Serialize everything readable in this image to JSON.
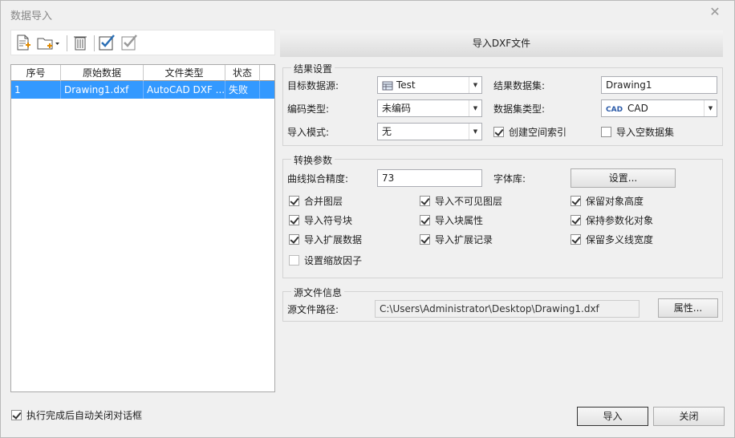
{
  "window": {
    "title": "数据导入",
    "close_glyph": "✕"
  },
  "toolbar": {
    "icons": [
      "add-file-icon",
      "add-folder-icon",
      "delete-icon",
      "select-all-icon",
      "invert-select-icon"
    ]
  },
  "grid": {
    "columns": [
      "序号",
      "原始数据",
      "文件类型",
      "状态"
    ],
    "rows": [
      {
        "index": "1",
        "source": "Drawing1.dxf",
        "type": "AutoCAD DXF ...",
        "status": "失败"
      }
    ]
  },
  "banner": {
    "label": "导入DXF文件"
  },
  "result": {
    "group_title": "结果设置",
    "target_ds_label": "目标数据源:",
    "target_ds_value": "Test",
    "result_dataset_label": "结果数据集:",
    "result_dataset_value": "Drawing1",
    "encoding_label": "编码类型:",
    "encoding_value": "未编码",
    "dataset_type_label": "数据集类型:",
    "dataset_type_icon_text": "CAD",
    "dataset_type_value": "CAD",
    "import_mode_label": "导入模式:",
    "import_mode_value": "无",
    "create_index_label": "创建空间索引",
    "create_index_checked": true,
    "import_empty_label": "导入空数据集",
    "import_empty_checked": false
  },
  "convert": {
    "group_title": "转换参数",
    "curve_label": "曲线拟合精度:",
    "curve_value": "73",
    "font_label": "字体库:",
    "font_button": "设置...",
    "options": [
      {
        "label": "合并图层",
        "checked": true
      },
      {
        "label": "导入不可见图层",
        "checked": true
      },
      {
        "label": "保留对象高度",
        "checked": true
      },
      {
        "label": "导入符号块",
        "checked": true
      },
      {
        "label": "导入块属性",
        "checked": true
      },
      {
        "label": "保持参数化对象",
        "checked": true
      },
      {
        "label": "导入扩展数据",
        "checked": true
      },
      {
        "label": "导入扩展记录",
        "checked": true
      },
      {
        "label": "保留多义线宽度",
        "checked": true
      },
      {
        "label": "设置缩放因子",
        "checked": false
      }
    ]
  },
  "source": {
    "group_title": "源文件信息",
    "path_label": "源文件路径:",
    "path_value": "C:\\Users\\Administrator\\Desktop\\Drawing1.dxf",
    "props_button": "属性..."
  },
  "footer": {
    "auto_close_label": "执行完成后自动关闭对话框",
    "auto_close_checked": true,
    "import_button": "导入",
    "close_button": "关闭"
  }
}
